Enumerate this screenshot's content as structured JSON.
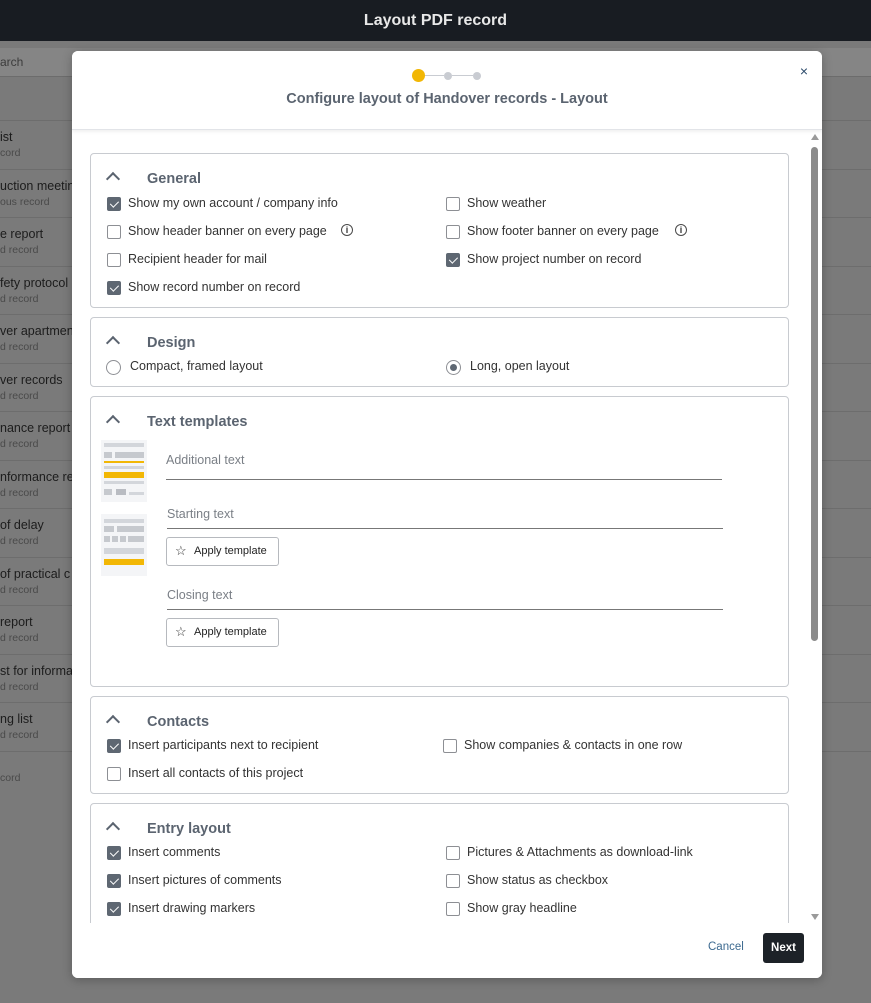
{
  "app": {
    "title": "Layout PDF record"
  },
  "background": {
    "search_placeholder": "arch",
    "rows": [
      {
        "title": "ist",
        "sub": "cord"
      },
      {
        "title": "uction meeting",
        "sub": "ous record"
      },
      {
        "title": "e report",
        "sub": "d record"
      },
      {
        "title": "fety protocol",
        "sub": "d record"
      },
      {
        "title": "ver apartment",
        "sub": "d record"
      },
      {
        "title": "ver records",
        "sub": "d record"
      },
      {
        "title": "nance report",
        "sub": "d record"
      },
      {
        "title": "nformance re",
        "sub": "d record"
      },
      {
        "title": "of delay",
        "sub": "d record"
      },
      {
        "title": "of practical c",
        "sub": "d record"
      },
      {
        "title": "report",
        "sub": "d record"
      },
      {
        "title": "st for informa",
        "sub": "d record"
      },
      {
        "title": "ng list",
        "sub": "d record"
      },
      {
        "title": "",
        "sub": "cord"
      }
    ]
  },
  "modal": {
    "title": "Configure layout of Handover records - Layout",
    "steps": {
      "current": 1,
      "total": 3
    },
    "close_label": "×",
    "general": {
      "title": "General",
      "options": [
        {
          "label": "Show my own account / company info",
          "checked": true
        },
        {
          "label": "Show weather",
          "checked": false
        },
        {
          "label": "Show header banner on every page",
          "checked": false
        },
        {
          "label": "Show footer banner on every page",
          "checked": false
        },
        {
          "label": "Recipient header for mail",
          "checked": false
        },
        {
          "label": "Show project number on record",
          "checked": true
        },
        {
          "label": "Show record number on record",
          "checked": true
        }
      ],
      "info_glyph": "i"
    },
    "design": {
      "title": "Design",
      "options": [
        {
          "label": "Compact, framed layout",
          "selected": false
        },
        {
          "label": "Long, open layout",
          "selected": true
        }
      ]
    },
    "text_templates": {
      "title": "Text templates",
      "fields": [
        {
          "label": "Additional text",
          "value": ""
        },
        {
          "label": "Starting text",
          "value": ""
        },
        {
          "label": "Closing text",
          "value": ""
        }
      ],
      "apply_label": "Apply template",
      "star_glyph": "☆"
    },
    "contacts": {
      "title": "Contacts",
      "options": [
        {
          "label": "Insert participants next to recipient",
          "checked": true
        },
        {
          "label": "Show companies & contacts in one row",
          "checked": false
        },
        {
          "label": "Insert all contacts of this project",
          "checked": false
        }
      ]
    },
    "entry_layout": {
      "title": "Entry layout",
      "options": [
        {
          "label": "Insert comments",
          "checked": true
        },
        {
          "label": "Pictures & Attachments as download-link",
          "checked": false
        },
        {
          "label": "Insert pictures of comments",
          "checked": true
        },
        {
          "label": "Show status as checkbox",
          "checked": false
        },
        {
          "label": "Insert drawing markers",
          "checked": true
        },
        {
          "label": "Show gray headline",
          "checked": false
        }
      ]
    },
    "footer": {
      "cancel_label": "Cancel",
      "next_label": "Next"
    }
  },
  "colors": {
    "accent": "#f2b705",
    "primary": "#1d2228",
    "link": "#3d6a90",
    "check": "#5e6772"
  }
}
